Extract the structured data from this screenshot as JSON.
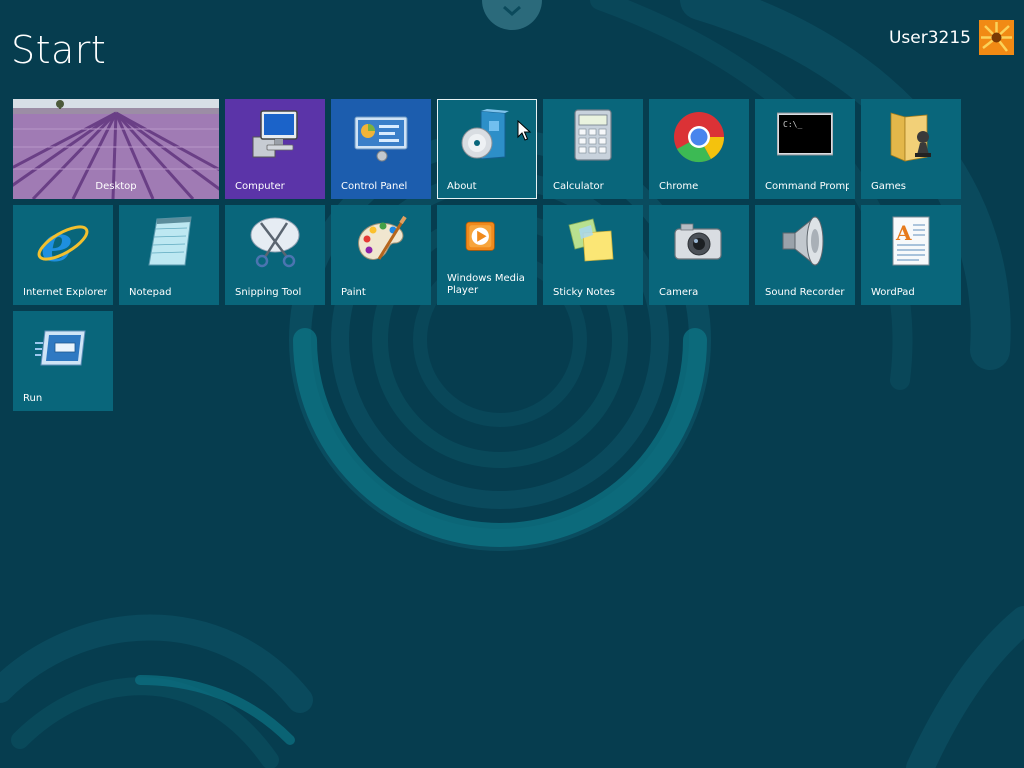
{
  "page_title": "Start",
  "user": {
    "name": "User3215",
    "avatar_icon": "flower-avatar-icon"
  },
  "colors": {
    "background": "#063d4f",
    "tile": "#09667b",
    "tile_purple": "#5b34a8",
    "tile_blue": "#1c5dae"
  },
  "tiles": [
    {
      "label": "Desktop",
      "icon": "desktop-lavender-field-image"
    },
    {
      "label": "Computer",
      "icon": "computer-icon"
    },
    {
      "label": "Control Panel",
      "icon": "control-panel-icon"
    },
    {
      "label": "About",
      "icon": "about-disc-icon",
      "selected": true
    },
    {
      "label": "Calculator",
      "icon": "calculator-icon"
    },
    {
      "label": "Chrome",
      "icon": "chrome-icon"
    },
    {
      "label": "Command Prompt",
      "icon": "command-prompt-icon"
    },
    {
      "label": "Games",
      "icon": "games-folder-icon"
    },
    {
      "label": "Internet Explorer",
      "icon": "internet-explorer-icon"
    },
    {
      "label": "Notepad",
      "icon": "notepad-icon"
    },
    {
      "label": "Snipping Tool",
      "icon": "snipping-tool-icon"
    },
    {
      "label": "Paint",
      "icon": "paint-palette-icon"
    },
    {
      "label": "Windows Media Player",
      "icon": "media-player-icon"
    },
    {
      "label": "Sticky Notes",
      "icon": "sticky-notes-icon"
    },
    {
      "label": "Camera",
      "icon": "camera-icon"
    },
    {
      "label": "Sound Recorder",
      "icon": "sound-recorder-icon"
    },
    {
      "label": "WordPad",
      "icon": "wordpad-icon"
    },
    {
      "label": "Run",
      "icon": "run-icon"
    }
  ]
}
